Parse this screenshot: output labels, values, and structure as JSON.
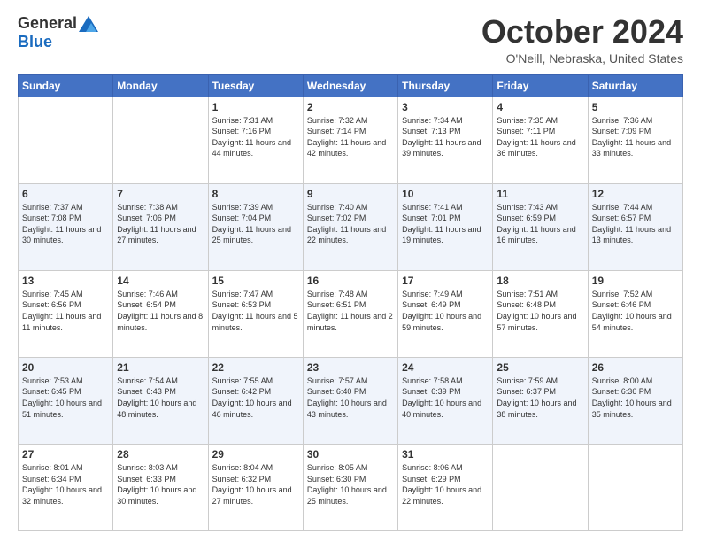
{
  "header": {
    "logo_general": "General",
    "logo_blue": "Blue",
    "month_title": "October 2024",
    "location": "O'Neill, Nebraska, United States"
  },
  "days_of_week": [
    "Sunday",
    "Monday",
    "Tuesday",
    "Wednesday",
    "Thursday",
    "Friday",
    "Saturday"
  ],
  "weeks": [
    [
      {
        "day": "",
        "sunrise": "",
        "sunset": "",
        "daylight": ""
      },
      {
        "day": "",
        "sunrise": "",
        "sunset": "",
        "daylight": ""
      },
      {
        "day": "1",
        "sunrise": "Sunrise: 7:31 AM",
        "sunset": "Sunset: 7:16 PM",
        "daylight": "Daylight: 11 hours and 44 minutes."
      },
      {
        "day": "2",
        "sunrise": "Sunrise: 7:32 AM",
        "sunset": "Sunset: 7:14 PM",
        "daylight": "Daylight: 11 hours and 42 minutes."
      },
      {
        "day": "3",
        "sunrise": "Sunrise: 7:34 AM",
        "sunset": "Sunset: 7:13 PM",
        "daylight": "Daylight: 11 hours and 39 minutes."
      },
      {
        "day": "4",
        "sunrise": "Sunrise: 7:35 AM",
        "sunset": "Sunset: 7:11 PM",
        "daylight": "Daylight: 11 hours and 36 minutes."
      },
      {
        "day": "5",
        "sunrise": "Sunrise: 7:36 AM",
        "sunset": "Sunset: 7:09 PM",
        "daylight": "Daylight: 11 hours and 33 minutes."
      }
    ],
    [
      {
        "day": "6",
        "sunrise": "Sunrise: 7:37 AM",
        "sunset": "Sunset: 7:08 PM",
        "daylight": "Daylight: 11 hours and 30 minutes."
      },
      {
        "day": "7",
        "sunrise": "Sunrise: 7:38 AM",
        "sunset": "Sunset: 7:06 PM",
        "daylight": "Daylight: 11 hours and 27 minutes."
      },
      {
        "day": "8",
        "sunrise": "Sunrise: 7:39 AM",
        "sunset": "Sunset: 7:04 PM",
        "daylight": "Daylight: 11 hours and 25 minutes."
      },
      {
        "day": "9",
        "sunrise": "Sunrise: 7:40 AM",
        "sunset": "Sunset: 7:02 PM",
        "daylight": "Daylight: 11 hours and 22 minutes."
      },
      {
        "day": "10",
        "sunrise": "Sunrise: 7:41 AM",
        "sunset": "Sunset: 7:01 PM",
        "daylight": "Daylight: 11 hours and 19 minutes."
      },
      {
        "day": "11",
        "sunrise": "Sunrise: 7:43 AM",
        "sunset": "Sunset: 6:59 PM",
        "daylight": "Daylight: 11 hours and 16 minutes."
      },
      {
        "day": "12",
        "sunrise": "Sunrise: 7:44 AM",
        "sunset": "Sunset: 6:57 PM",
        "daylight": "Daylight: 11 hours and 13 minutes."
      }
    ],
    [
      {
        "day": "13",
        "sunrise": "Sunrise: 7:45 AM",
        "sunset": "Sunset: 6:56 PM",
        "daylight": "Daylight: 11 hours and 11 minutes."
      },
      {
        "day": "14",
        "sunrise": "Sunrise: 7:46 AM",
        "sunset": "Sunset: 6:54 PM",
        "daylight": "Daylight: 11 hours and 8 minutes."
      },
      {
        "day": "15",
        "sunrise": "Sunrise: 7:47 AM",
        "sunset": "Sunset: 6:53 PM",
        "daylight": "Daylight: 11 hours and 5 minutes."
      },
      {
        "day": "16",
        "sunrise": "Sunrise: 7:48 AM",
        "sunset": "Sunset: 6:51 PM",
        "daylight": "Daylight: 11 hours and 2 minutes."
      },
      {
        "day": "17",
        "sunrise": "Sunrise: 7:49 AM",
        "sunset": "Sunset: 6:49 PM",
        "daylight": "Daylight: 10 hours and 59 minutes."
      },
      {
        "day": "18",
        "sunrise": "Sunrise: 7:51 AM",
        "sunset": "Sunset: 6:48 PM",
        "daylight": "Daylight: 10 hours and 57 minutes."
      },
      {
        "day": "19",
        "sunrise": "Sunrise: 7:52 AM",
        "sunset": "Sunset: 6:46 PM",
        "daylight": "Daylight: 10 hours and 54 minutes."
      }
    ],
    [
      {
        "day": "20",
        "sunrise": "Sunrise: 7:53 AM",
        "sunset": "Sunset: 6:45 PM",
        "daylight": "Daylight: 10 hours and 51 minutes."
      },
      {
        "day": "21",
        "sunrise": "Sunrise: 7:54 AM",
        "sunset": "Sunset: 6:43 PM",
        "daylight": "Daylight: 10 hours and 48 minutes."
      },
      {
        "day": "22",
        "sunrise": "Sunrise: 7:55 AM",
        "sunset": "Sunset: 6:42 PM",
        "daylight": "Daylight: 10 hours and 46 minutes."
      },
      {
        "day": "23",
        "sunrise": "Sunrise: 7:57 AM",
        "sunset": "Sunset: 6:40 PM",
        "daylight": "Daylight: 10 hours and 43 minutes."
      },
      {
        "day": "24",
        "sunrise": "Sunrise: 7:58 AM",
        "sunset": "Sunset: 6:39 PM",
        "daylight": "Daylight: 10 hours and 40 minutes."
      },
      {
        "day": "25",
        "sunrise": "Sunrise: 7:59 AM",
        "sunset": "Sunset: 6:37 PM",
        "daylight": "Daylight: 10 hours and 38 minutes."
      },
      {
        "day": "26",
        "sunrise": "Sunrise: 8:00 AM",
        "sunset": "Sunset: 6:36 PM",
        "daylight": "Daylight: 10 hours and 35 minutes."
      }
    ],
    [
      {
        "day": "27",
        "sunrise": "Sunrise: 8:01 AM",
        "sunset": "Sunset: 6:34 PM",
        "daylight": "Daylight: 10 hours and 32 minutes."
      },
      {
        "day": "28",
        "sunrise": "Sunrise: 8:03 AM",
        "sunset": "Sunset: 6:33 PM",
        "daylight": "Daylight: 10 hours and 30 minutes."
      },
      {
        "day": "29",
        "sunrise": "Sunrise: 8:04 AM",
        "sunset": "Sunset: 6:32 PM",
        "daylight": "Daylight: 10 hours and 27 minutes."
      },
      {
        "day": "30",
        "sunrise": "Sunrise: 8:05 AM",
        "sunset": "Sunset: 6:30 PM",
        "daylight": "Daylight: 10 hours and 25 minutes."
      },
      {
        "day": "31",
        "sunrise": "Sunrise: 8:06 AM",
        "sunset": "Sunset: 6:29 PM",
        "daylight": "Daylight: 10 hours and 22 minutes."
      },
      {
        "day": "",
        "sunrise": "",
        "sunset": "",
        "daylight": ""
      },
      {
        "day": "",
        "sunrise": "",
        "sunset": "",
        "daylight": ""
      }
    ]
  ]
}
